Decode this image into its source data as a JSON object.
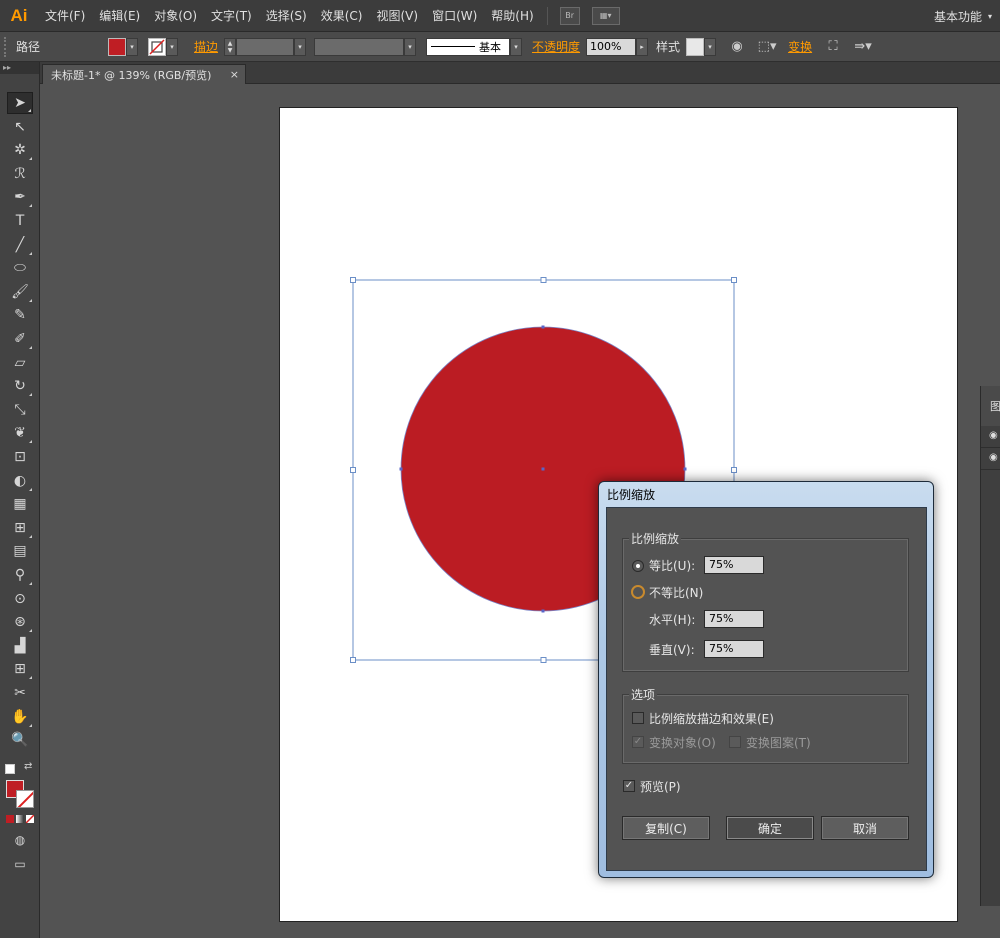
{
  "app": {
    "logo": "Ai",
    "menu": [
      "文件(F)",
      "编辑(E)",
      "对象(O)",
      "文字(T)",
      "选择(S)",
      "效果(C)",
      "视图(V)",
      "窗口(W)",
      "帮助(H)"
    ],
    "bridge_label": "Br",
    "workspace": "基本功能"
  },
  "control_bar": {
    "selection_type": "路径",
    "stroke_label": "描边",
    "stroke_profile": "基本",
    "opacity_label": "不透明度",
    "opacity_value": "100%",
    "style_label": "样式",
    "transform_label": "变换",
    "fill_color": "#bf1e24"
  },
  "document": {
    "tab_title": "未标题-1* @ 139% (RGB/预览)",
    "close_glyph": "×",
    "circle_color": "#bb1c23",
    "selection_color": "#6b8fc7"
  },
  "tools": [
    "selection-tool-icon",
    "direct-selection-tool-icon",
    "magic-wand-tool-icon",
    "lasso-tool-icon",
    "pen-tool-icon",
    "type-tool-icon",
    "line-segment-tool-icon",
    "ellipse-tool-icon",
    "paintbrush-tool-icon",
    "pencil-tool-icon",
    "blob-brush-tool-icon",
    "eraser-tool-icon",
    "rotate-tool-icon",
    "scale-tool-icon",
    "warp-tool-icon",
    "free-transform-tool-icon",
    "shape-builder-tool-icon",
    "perspective-grid-tool-icon",
    "mesh-tool-icon",
    "gradient-tool-icon",
    "eyedropper-tool-icon",
    "blend-tool-icon",
    "symbol-sprayer-tool-icon",
    "column-graph-tool-icon",
    "artboard-tool-icon",
    "slice-tool-icon",
    "hand-tool-icon",
    "zoom-tool-icon"
  ],
  "tool_glyphs": [
    "➤",
    "↖",
    "✲",
    "ℛ",
    "✒",
    "T",
    "╱",
    "⬭",
    "🖌",
    "✎",
    "✐",
    "▱",
    "↻",
    "⤡",
    "❦",
    "⊡",
    "◐",
    "▦",
    "⊞",
    "▤",
    "⚲",
    "⊙",
    "⊛",
    "▟",
    "⊞",
    "✂",
    "✋",
    "🔍"
  ],
  "dialog": {
    "title": "比例缩放",
    "scale_group_title": "比例缩放",
    "uniform_label": "等比(U):",
    "uniform_value": "75%",
    "nonuniform_label": "不等比(N)",
    "horizontal_label": "水平(H):",
    "horizontal_value": "75%",
    "vertical_label": "垂直(V):",
    "vertical_value": "75%",
    "options_group_title": "选项",
    "scale_strokes_label": "比例缩放描边和效果(E)",
    "transform_objects_label": "变换对象(O)",
    "transform_patterns_label": "变换图案(T)",
    "preview_label": "预览(P)",
    "copy_button": "复制(C)",
    "ok_button": "确定",
    "cancel_button": "取消"
  }
}
